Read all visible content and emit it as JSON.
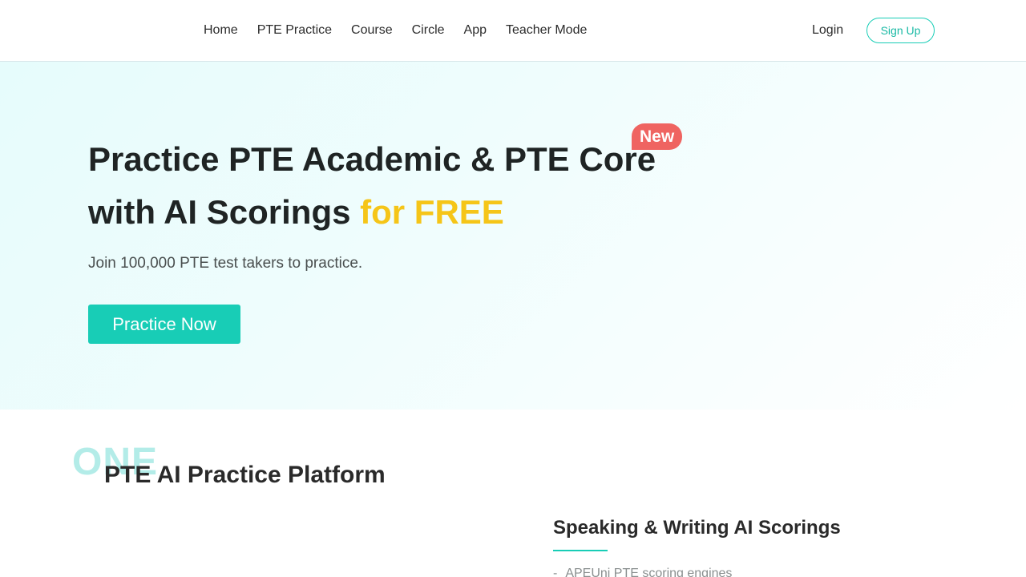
{
  "nav": {
    "items": [
      {
        "label": "Home"
      },
      {
        "label": "PTE Practice"
      },
      {
        "label": "Course"
      },
      {
        "label": "Circle"
      },
      {
        "label": "App"
      },
      {
        "label": "Teacher Mode"
      }
    ],
    "login_label": "Login",
    "signup_label": "Sign Up"
  },
  "hero": {
    "title_line1": "Practice PTE Academic & PTE Core",
    "title_line2": "with AI Scorings ",
    "title_accent": "for FREE",
    "badge": "New",
    "subtitle": "Join 100,000 PTE test takers to practice.",
    "cta_label": "Practice Now",
    "accent_color": "#f5c518",
    "brand_color": "#18cdb6",
    "badge_color": "#ef6461"
  },
  "section": {
    "number_label": "ONE",
    "title": "PTE AI Practice Platform",
    "feature_title": "Speaking & Writing AI Scorings",
    "feature_items": [
      {
        "dash": "-",
        "text": "APEUni PTE scoring engines"
      }
    ]
  }
}
